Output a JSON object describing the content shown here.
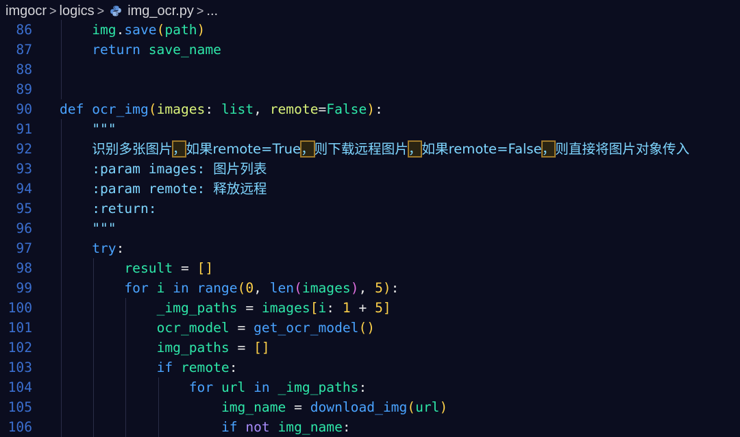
{
  "breadcrumb": {
    "items": [
      "imgocr",
      "logics",
      "img_ocr.py",
      "..."
    ]
  },
  "editor": {
    "lines": [
      {
        "n": "86",
        "tokens": [
          [
            "    ",
            "pl"
          ],
          [
            "img",
            "var"
          ],
          [
            ".",
            "op"
          ],
          [
            "save",
            "fn"
          ],
          [
            "(",
            "p1"
          ],
          [
            "path",
            "var"
          ],
          [
            ")",
            "p1"
          ]
        ]
      },
      {
        "n": "87",
        "tokens": [
          [
            "    ",
            "pl"
          ],
          [
            "return",
            "kw"
          ],
          [
            " ",
            "pl"
          ],
          [
            "save_name",
            "var"
          ]
        ]
      },
      {
        "n": "88",
        "tokens": []
      },
      {
        "n": "89",
        "tokens": []
      },
      {
        "n": "90",
        "tokens": [
          [
            "def",
            "kw"
          ],
          [
            " ",
            "pl"
          ],
          [
            "ocr_img",
            "fn"
          ],
          [
            "(",
            "p1"
          ],
          [
            "images",
            "id"
          ],
          [
            ": ",
            "op"
          ],
          [
            "list",
            "var"
          ],
          [
            ", ",
            "op"
          ],
          [
            "remote",
            "id"
          ],
          [
            "=",
            "op"
          ],
          [
            "False",
            "var"
          ],
          [
            ")",
            "p1"
          ],
          [
            ":",
            "op"
          ]
        ]
      },
      {
        "n": "91",
        "tokens": [
          [
            "    ",
            "pl"
          ],
          [
            "\"\"\"",
            "doc"
          ]
        ]
      },
      {
        "n": "92",
        "tokens": [
          [
            "    ",
            "pl"
          ],
          [
            "识别多张图片",
            "doc cjk"
          ],
          [
            "，",
            "doc cjk hl"
          ],
          [
            "如果remote=True",
            "doc cjk"
          ],
          [
            "，",
            "doc cjk hl"
          ],
          [
            "则下载远程图片",
            "doc cjk"
          ],
          [
            "，",
            "doc cjk hl"
          ],
          [
            "如果remote=False",
            "doc cjk"
          ],
          [
            "，",
            "doc cjk hl"
          ],
          [
            "则直接将图片对象传入",
            "doc cjk"
          ]
        ]
      },
      {
        "n": "93",
        "tokens": [
          [
            "    ",
            "pl"
          ],
          [
            ":param images: ",
            "doc"
          ],
          [
            "图片列表",
            "doc cjk"
          ]
        ]
      },
      {
        "n": "94",
        "tokens": [
          [
            "    ",
            "pl"
          ],
          [
            ":param remote: ",
            "doc"
          ],
          [
            "释放远程",
            "doc cjk"
          ]
        ]
      },
      {
        "n": "95",
        "tokens": [
          [
            "    ",
            "pl"
          ],
          [
            ":return:",
            "doc"
          ]
        ]
      },
      {
        "n": "96",
        "tokens": [
          [
            "    ",
            "pl"
          ],
          [
            "\"\"\"",
            "doc"
          ]
        ]
      },
      {
        "n": "97",
        "tokens": [
          [
            "    ",
            "pl"
          ],
          [
            "try",
            "kw"
          ],
          [
            ":",
            "op"
          ]
        ]
      },
      {
        "n": "98",
        "tokens": [
          [
            "        ",
            "pl"
          ],
          [
            "result",
            "var"
          ],
          [
            " = ",
            "op"
          ],
          [
            "[]",
            "p1"
          ]
        ]
      },
      {
        "n": "99",
        "tokens": [
          [
            "        ",
            "pl"
          ],
          [
            "for",
            "kw"
          ],
          [
            " ",
            "pl"
          ],
          [
            "i",
            "var"
          ],
          [
            " ",
            "pl"
          ],
          [
            "in",
            "kw"
          ],
          [
            " ",
            "pl"
          ],
          [
            "range",
            "fn"
          ],
          [
            "(",
            "p1"
          ],
          [
            "0",
            "num"
          ],
          [
            ", ",
            "op"
          ],
          [
            "len",
            "fn"
          ],
          [
            "(",
            "p2"
          ],
          [
            "images",
            "var"
          ],
          [
            ")",
            "p2"
          ],
          [
            ", ",
            "op"
          ],
          [
            "5",
            "num"
          ],
          [
            ")",
            "p1"
          ],
          [
            ":",
            "op"
          ]
        ]
      },
      {
        "n": "100",
        "tokens": [
          [
            "            ",
            "pl"
          ],
          [
            "_img_paths",
            "var"
          ],
          [
            " = ",
            "op"
          ],
          [
            "images",
            "var"
          ],
          [
            "[",
            "p1"
          ],
          [
            "i",
            "var"
          ],
          [
            ": ",
            "op"
          ],
          [
            "1",
            "num"
          ],
          [
            " + ",
            "op"
          ],
          [
            "5",
            "num"
          ],
          [
            "]",
            "p1"
          ]
        ]
      },
      {
        "n": "101",
        "tokens": [
          [
            "            ",
            "pl"
          ],
          [
            "ocr_model",
            "var"
          ],
          [
            " = ",
            "op"
          ],
          [
            "get_ocr_model",
            "fn"
          ],
          [
            "()",
            "p1"
          ]
        ]
      },
      {
        "n": "102",
        "tokens": [
          [
            "            ",
            "pl"
          ],
          [
            "img_paths",
            "var"
          ],
          [
            " = ",
            "op"
          ],
          [
            "[]",
            "p1"
          ]
        ]
      },
      {
        "n": "103",
        "tokens": [
          [
            "            ",
            "pl"
          ],
          [
            "if",
            "kw"
          ],
          [
            " ",
            "pl"
          ],
          [
            "remote",
            "var"
          ],
          [
            ":",
            "op"
          ]
        ]
      },
      {
        "n": "104",
        "tokens": [
          [
            "                ",
            "pl"
          ],
          [
            "for",
            "kw"
          ],
          [
            " ",
            "pl"
          ],
          [
            "url",
            "var"
          ],
          [
            " ",
            "pl"
          ],
          [
            "in",
            "kw"
          ],
          [
            " ",
            "pl"
          ],
          [
            "_img_paths",
            "var"
          ],
          [
            ":",
            "op"
          ]
        ]
      },
      {
        "n": "105",
        "tokens": [
          [
            "                    ",
            "pl"
          ],
          [
            "img_name",
            "var"
          ],
          [
            " = ",
            "op"
          ],
          [
            "download_img",
            "fn"
          ],
          [
            "(",
            "p1"
          ],
          [
            "url",
            "var"
          ],
          [
            ")",
            "p1"
          ]
        ]
      },
      {
        "n": "106",
        "tokens": [
          [
            "                    ",
            "pl"
          ],
          [
            "if",
            "kw"
          ],
          [
            " ",
            "pl"
          ],
          [
            "not",
            "kw2"
          ],
          [
            " ",
            "pl"
          ],
          [
            "img_name",
            "var"
          ],
          [
            ":",
            "op"
          ]
        ]
      }
    ]
  },
  "colors": {
    "background": "#0b0d1f",
    "line_number": "#3b6fd0",
    "keyword": "#4aa3ff",
    "variable": "#2ee6a8",
    "docstring": "#7fd6ff",
    "number": "#ffd24a"
  },
  "icons": {
    "file_icon": "python-file-icon",
    "separator": "chevron-right-icon"
  }
}
